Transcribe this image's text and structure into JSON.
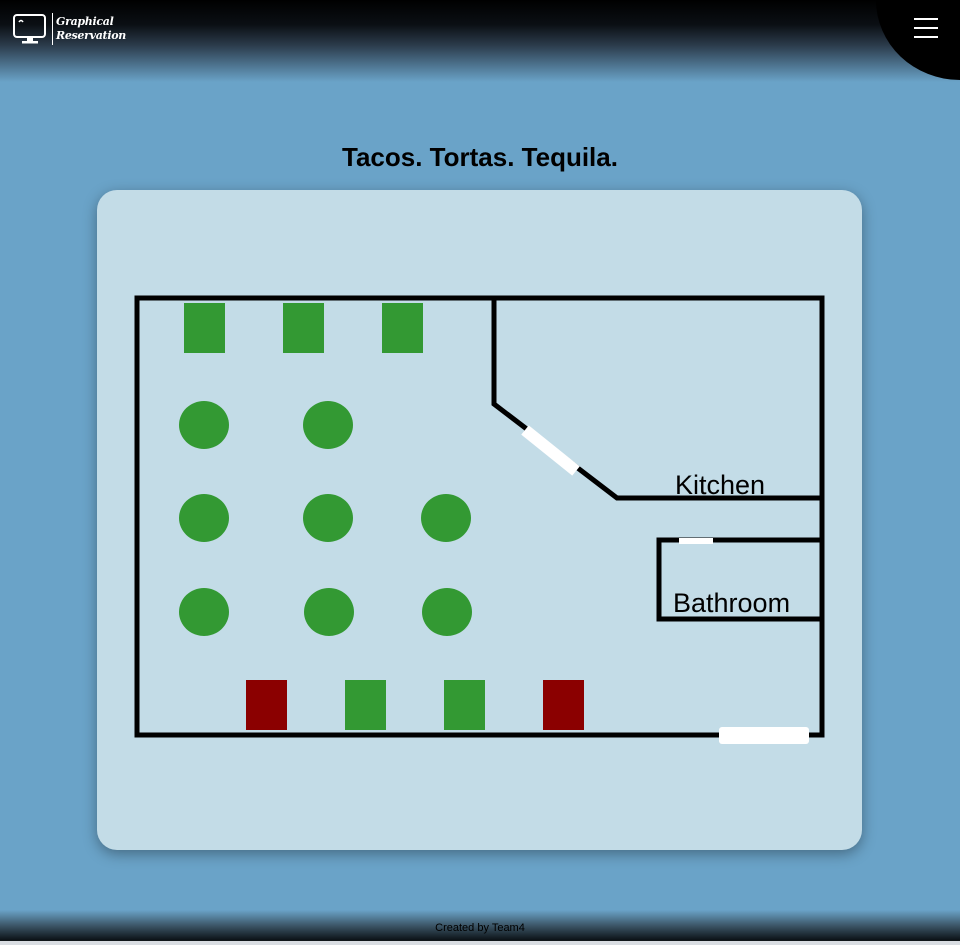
{
  "header": {
    "logo": {
      "icon": "monitor-icon",
      "line1": "Graphical",
      "line2": "Reservation"
    },
    "menu_icon": "hamburger-menu-icon"
  },
  "title": "Tacos. Tortas. Tequila.",
  "floor_plan": {
    "rooms": {
      "kitchen": "Kitchen",
      "bathroom": "Bathroom"
    },
    "colors": {
      "available": "#339933",
      "reserved": "#8b0000",
      "wall": "#000000",
      "door": "#ffffff",
      "floor": "#c3dce7"
    },
    "tables": [
      {
        "id": "T1",
        "shape": "rect",
        "status": "available"
      },
      {
        "id": "T2",
        "shape": "rect",
        "status": "available"
      },
      {
        "id": "T3",
        "shape": "rect",
        "status": "available"
      },
      {
        "id": "T4",
        "shape": "round",
        "status": "available"
      },
      {
        "id": "T5",
        "shape": "round",
        "status": "available"
      },
      {
        "id": "T6",
        "shape": "round",
        "status": "available"
      },
      {
        "id": "T7",
        "shape": "round",
        "status": "available"
      },
      {
        "id": "T8",
        "shape": "round",
        "status": "available"
      },
      {
        "id": "T9",
        "shape": "round",
        "status": "available"
      },
      {
        "id": "T10",
        "shape": "round",
        "status": "available"
      },
      {
        "id": "T11",
        "shape": "round",
        "status": "available"
      },
      {
        "id": "T12",
        "shape": "rect",
        "status": "reserved"
      },
      {
        "id": "T13",
        "shape": "rect",
        "status": "available"
      },
      {
        "id": "T14",
        "shape": "rect",
        "status": "available"
      },
      {
        "id": "T15",
        "shape": "rect",
        "status": "reserved"
      }
    ]
  },
  "footer": {
    "credit": "Created by Team4"
  }
}
